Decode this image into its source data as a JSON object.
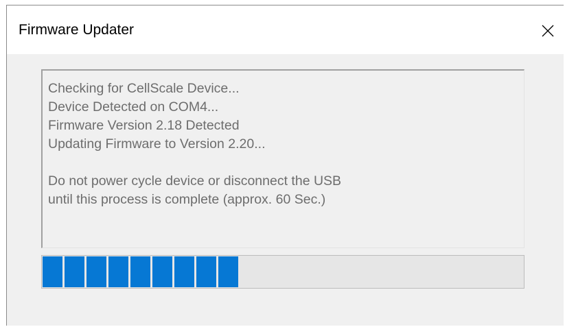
{
  "window": {
    "title": "Firmware Updater",
    "close_icon": "close-icon"
  },
  "log": {
    "lines": [
      "Checking for CellScale Device...",
      "Device Detected on COM4...",
      "Firmware Version 2.18 Detected",
      "Updating Firmware to Version 2.20...",
      "",
      "Do not power cycle device or disconnect the USB",
      "until this process is complete (approx. 60 Sec.)"
    ]
  },
  "progress": {
    "fraction": 0.41,
    "blocks_filled": 9,
    "color": "#0678d4"
  }
}
